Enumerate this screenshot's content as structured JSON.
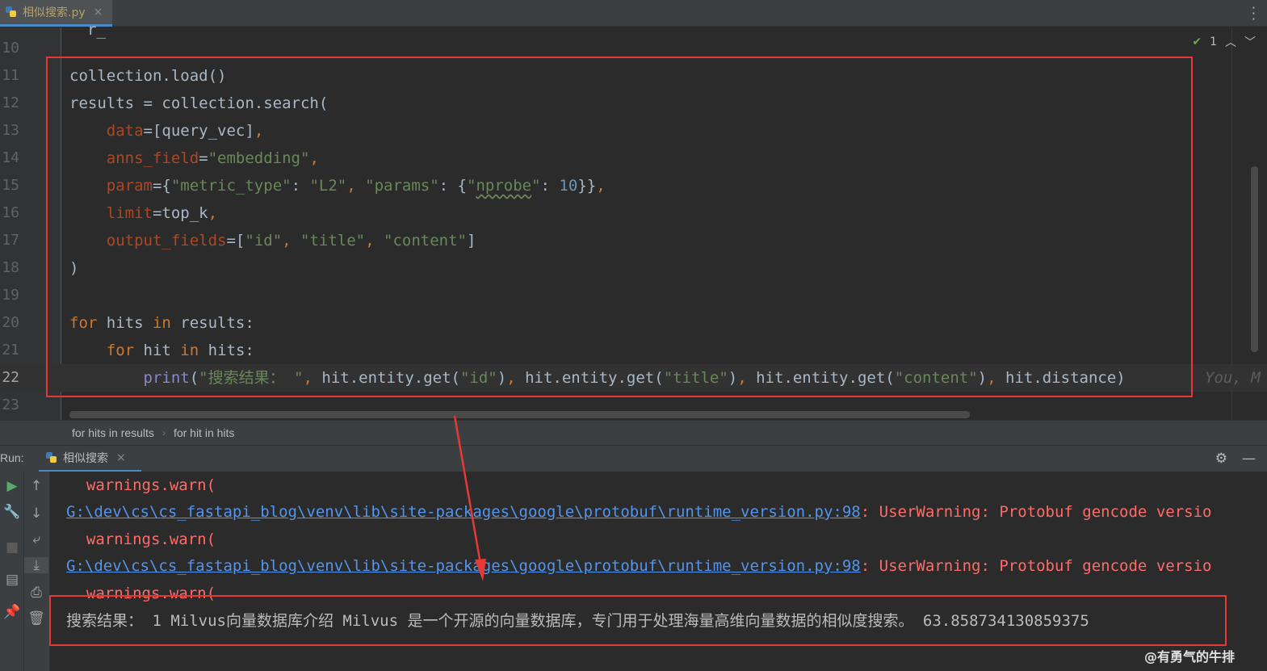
{
  "tab": {
    "filename": "相似搜索.py",
    "close": "×"
  },
  "inspection": {
    "count": "1",
    "up": "⌃",
    "down": "⌄"
  },
  "editor": {
    "lines": [
      {
        "n": "10"
      },
      {
        "n": "11"
      },
      {
        "n": "12"
      },
      {
        "n": "13"
      },
      {
        "n": "14"
      },
      {
        "n": "15"
      },
      {
        "n": "16"
      },
      {
        "n": "17"
      },
      {
        "n": "18"
      },
      {
        "n": "19"
      },
      {
        "n": "20"
      },
      {
        "n": "21"
      },
      {
        "n": "22"
      },
      {
        "n": "23"
      }
    ],
    "inline_hint": "You, M"
  },
  "breadcrumb": {
    "items": [
      "for hits in results",
      "for hit in hits"
    ]
  },
  "run": {
    "label": "Run:",
    "tab": "相似搜索",
    "close": "×"
  },
  "console": {
    "warn1": "  warnings.warn(",
    "path1": "G:\\dev\\cs\\cs_fastapi_blog\\venv\\lib\\site-packages\\google\\protobuf\\runtime_version.py:98",
    "msg1": ": UserWarning: Protobuf gencode versio",
    "warn2": "  warnings.warn(",
    "path2": "G:\\dev\\cs\\cs_fastapi_blog\\venv\\lib\\site-packages\\google\\protobuf\\runtime_version.py:98",
    "msg2": ": UserWarning: Protobuf gencode versio",
    "warn3": "  warnings.warn(",
    "result": "搜索结果： 1 Milvus向量数据库介绍 Milvus 是一个开源的向量数据库，专门用于处理海量高维向量数据的相似度搜索。 63.858734130859375"
  },
  "watermark": "@有勇气的牛排",
  "colors": {
    "highlight_box": "#e53935",
    "accent": "#4a88c7"
  }
}
